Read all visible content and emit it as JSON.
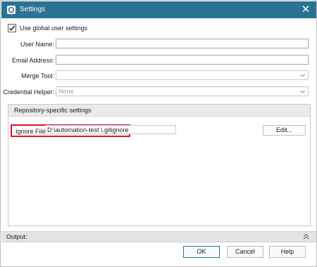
{
  "window": {
    "title": "Settings",
    "close_glyph": "✕"
  },
  "use_global": {
    "label": "Use global user settings",
    "checked": true
  },
  "fields": {
    "user_name": {
      "label": "User Name:",
      "value": ""
    },
    "email": {
      "label": "Email Address:",
      "value": ""
    },
    "merge_tool": {
      "label": "Merge Tool:",
      "value": ""
    },
    "credential_helper": {
      "label": "Credential Helper:",
      "value": "None"
    }
  },
  "repo_group": {
    "title": "Repository-specific settings",
    "ignore_file_label": "Ignore File:",
    "ignore_file_value": "D:\\automation-test  \\.gitignore",
    "edit_button": "Edit..."
  },
  "output": {
    "label": "Output:"
  },
  "buttons": {
    "ok": "OK",
    "cancel": "Cancel",
    "help": "Help"
  },
  "colors": {
    "titlebar": "#2a7393",
    "highlight": "#e0102a"
  }
}
